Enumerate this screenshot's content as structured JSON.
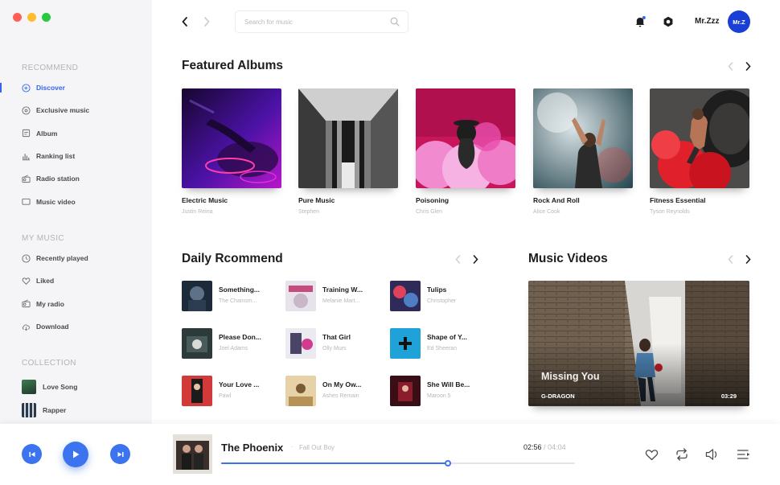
{
  "window": {
    "traffic_lights": [
      "#fe5f57",
      "#febc2e",
      "#28c840"
    ]
  },
  "colors": {
    "accent": "#3565f0",
    "player_accent": "#3b74ee"
  },
  "sidebar": {
    "recommend_title": "RECOMMEND",
    "recommend_items": [
      {
        "label": "Discover",
        "icon": "discover-icon",
        "active": true
      },
      {
        "label": "Exclusive music",
        "icon": "disc-icon"
      },
      {
        "label": "Album",
        "icon": "album-icon"
      },
      {
        "label": "Ranking list",
        "icon": "ranking-icon"
      },
      {
        "label": "Radio station",
        "icon": "radio-icon"
      },
      {
        "label": "Music video",
        "icon": "video-icon"
      }
    ],
    "mymusic_title": "MY MUSIC",
    "mymusic_items": [
      {
        "label": "Recently played",
        "icon": "clock-icon"
      },
      {
        "label": "Liked",
        "icon": "heart-icon"
      },
      {
        "label": "My radio",
        "icon": "radio-icon"
      },
      {
        "label": "Download",
        "icon": "download-icon"
      }
    ],
    "collection_title": "COLLECTION",
    "collection_items": [
      {
        "label": "Love Song"
      },
      {
        "label": "Rapper"
      }
    ]
  },
  "header": {
    "search_placeholder": "Search for music",
    "user_name": "Mr.Zzz",
    "avatar_text": "Mr.Z",
    "notification_dot": true
  },
  "featured": {
    "title": "Featured Albums",
    "albums": [
      {
        "title": "Electric Music",
        "artist": "Justin Reina"
      },
      {
        "title": "Pure Music",
        "artist": "Stephen"
      },
      {
        "title": "Poisoning",
        "artist": "Chris Glen"
      },
      {
        "title": "Rock And Roll",
        "artist": "Alice Cook"
      },
      {
        "title": "Fitness Essential",
        "artist": "Tyson Reynolds"
      }
    ]
  },
  "daily": {
    "title": "Daily Rcommend",
    "songs": [
      {
        "title": "Something...",
        "artist": "The Chainsm..."
      },
      {
        "title": "Training W...",
        "artist": "Melanie Mart..."
      },
      {
        "title": "Tulips",
        "artist": "Christopher"
      },
      {
        "title": "Please Don...",
        "artist": "Joel Adams"
      },
      {
        "title": "That Girl",
        "artist": "Olly Murs"
      },
      {
        "title": "Shape of Y...",
        "artist": "Ed Sheeran"
      },
      {
        "title": "Your Love ...",
        "artist": "Pawl"
      },
      {
        "title": "On My Ow...",
        "artist": "Ashes Remain"
      },
      {
        "title": "She Will Be...",
        "artist": "Maroon 5"
      }
    ]
  },
  "videos": {
    "title": "Music Videos",
    "item": {
      "title": "Missing You",
      "artist": "G-DRAGON",
      "duration": "03:29"
    }
  },
  "player": {
    "title": "The Phoenix",
    "separator": "·",
    "artist": "Fall Out Boy",
    "current": "02:56",
    "sep": "/",
    "total": "04:04",
    "progress": 0.64
  }
}
